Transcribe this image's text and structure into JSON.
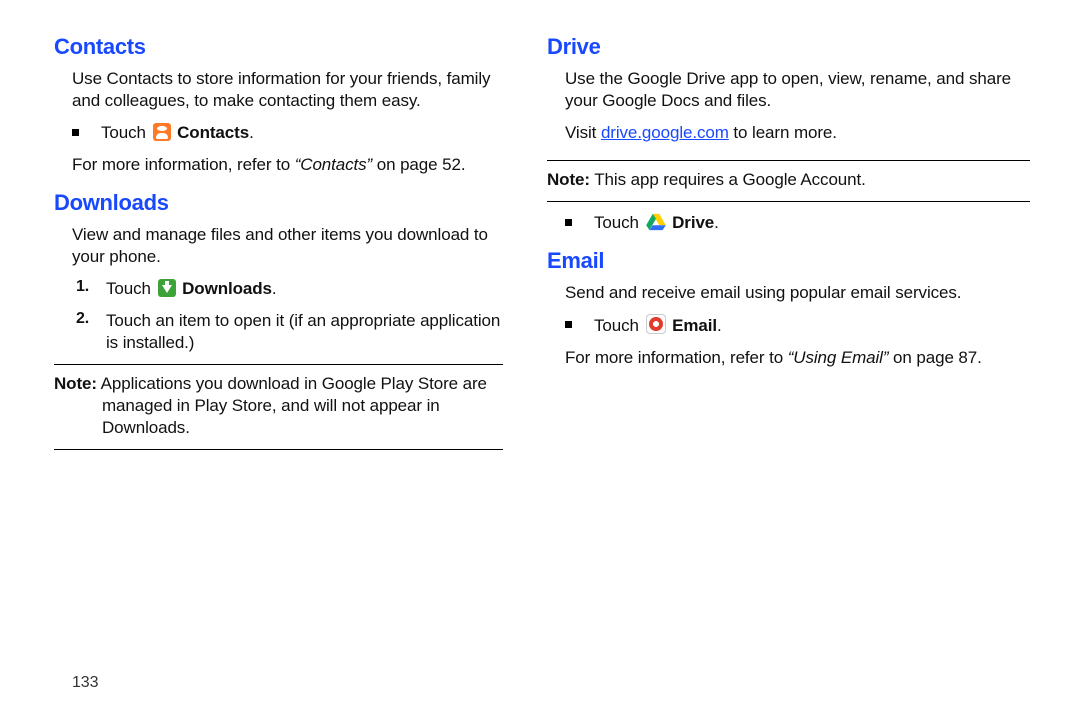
{
  "page_number": "133",
  "left": {
    "contacts": {
      "heading": "Contacts",
      "para": "Use Contacts to store information for your friends, family and colleagues, to make contacting them easy.",
      "touch_prefix": "Touch ",
      "touch_app": "Contacts",
      "more_before": "For more information, refer to ",
      "more_ref": "“Contacts”",
      "more_after": " on page 52."
    },
    "downloads": {
      "heading": "Downloads",
      "para": "View and manage files and other items you download to your phone.",
      "step1_num": "1.",
      "step1_prefix": "Touch ",
      "step1_app": "Downloads",
      "step2_num": "2.",
      "step2_text": "Touch an item to open it (if an appropriate application is installed.)",
      "note_label": "Note:",
      "note_text": " Applications you download in Google Play Store are managed in Play Store, and will not appear in Downloads."
    }
  },
  "right": {
    "drive": {
      "heading": "Drive",
      "para": "Use the Google Drive app to open, view, rename, and share your Google Docs and files.",
      "visit_before": "Visit ",
      "visit_link": "drive.google.com",
      "visit_after": " to learn more.",
      "note_label": "Note:",
      "note_text": " This app requires a Google Account.",
      "touch_prefix": "Touch ",
      "touch_app": "Drive"
    },
    "email": {
      "heading": "Email",
      "para": "Send and receive email using popular email services.",
      "touch_prefix": "Touch ",
      "touch_app": "Email",
      "more_before": "For more information, refer to ",
      "more_ref": "“Using Email”",
      "more_after": " on page 87."
    }
  }
}
